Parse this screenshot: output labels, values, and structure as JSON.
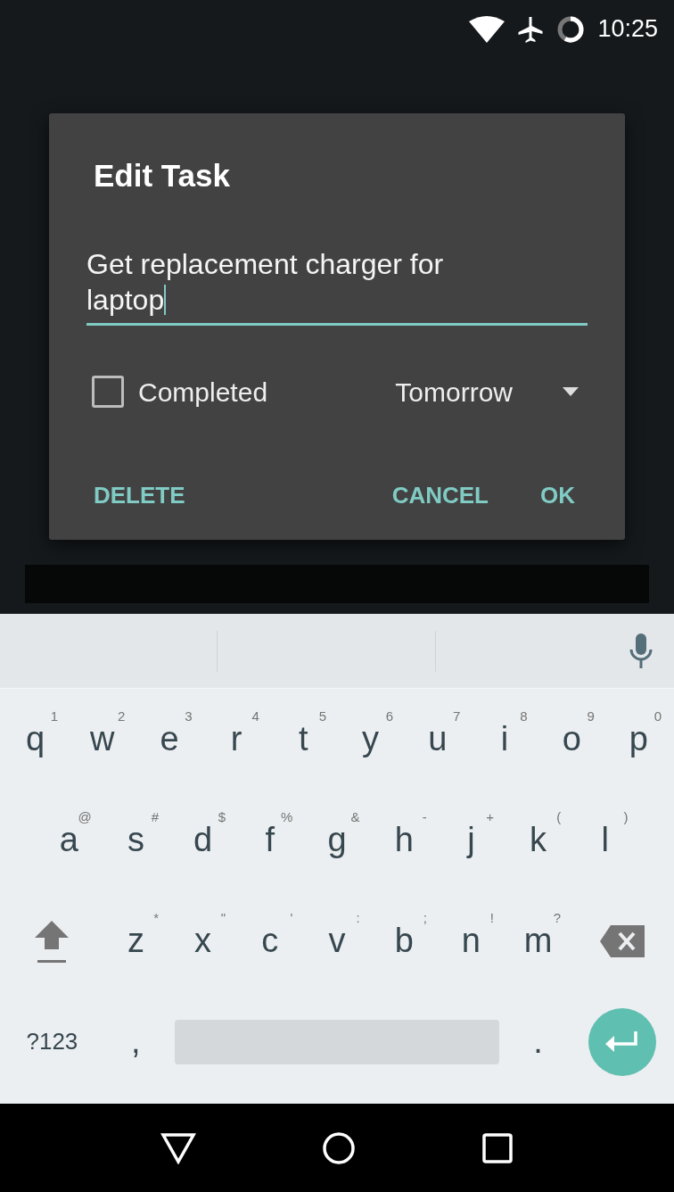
{
  "status_bar": {
    "time": "10:25"
  },
  "dialog": {
    "title": "Edit Task",
    "task_text": "Get replacement charger for laptop",
    "completed": {
      "label": "Completed",
      "checked": false
    },
    "due": {
      "value": "Tomorrow"
    },
    "buttons": [
      {
        "label": "DELETE",
        "kind": "left"
      },
      {
        "label": "CANCEL",
        "kind": "right"
      },
      {
        "label": "OK",
        "kind": "right"
      }
    ]
  },
  "keyboard": {
    "rows": [
      {
        "keys": [
          {
            "kind": "letter",
            "label": "q",
            "hint": "1"
          },
          {
            "kind": "letter",
            "label": "w",
            "hint": "2"
          },
          {
            "kind": "letter",
            "label": "e",
            "hint": "3"
          },
          {
            "kind": "letter",
            "label": "r",
            "hint": "4"
          },
          {
            "kind": "letter",
            "label": "t",
            "hint": "5"
          },
          {
            "kind": "letter",
            "label": "y",
            "hint": "6"
          },
          {
            "kind": "letter",
            "label": "u",
            "hint": "7"
          },
          {
            "kind": "letter",
            "label": "i",
            "hint": "8"
          },
          {
            "kind": "letter",
            "label": "o",
            "hint": "9"
          },
          {
            "kind": "letter",
            "label": "p",
            "hint": "0"
          }
        ]
      },
      {
        "keys": [
          {
            "kind": "letter",
            "label": "a",
            "hint": "@"
          },
          {
            "kind": "letter",
            "label": "s",
            "hint": "#"
          },
          {
            "kind": "letter",
            "label": "d",
            "hint": "$"
          },
          {
            "kind": "letter",
            "label": "f",
            "hint": "%"
          },
          {
            "kind": "letter",
            "label": "g",
            "hint": "&"
          },
          {
            "kind": "letter",
            "label": "h",
            "hint": "-"
          },
          {
            "kind": "letter",
            "label": "j",
            "hint": "+"
          },
          {
            "kind": "letter",
            "label": "k",
            "hint": "("
          },
          {
            "kind": "letter",
            "label": "l",
            "hint": ")"
          }
        ]
      },
      {
        "keys": [
          {
            "kind": "shift"
          },
          {
            "kind": "letter",
            "label": "z",
            "hint": "*"
          },
          {
            "kind": "letter",
            "label": "x",
            "hint": "\""
          },
          {
            "kind": "letter",
            "label": "c",
            "hint": "'"
          },
          {
            "kind": "letter",
            "label": "v",
            "hint": ":"
          },
          {
            "kind": "letter",
            "label": "b",
            "hint": ";"
          },
          {
            "kind": "letter",
            "label": "n",
            "hint": "!"
          },
          {
            "kind": "letter",
            "label": "m",
            "hint": "?"
          },
          {
            "kind": "backspace"
          }
        ]
      },
      {
        "keys": [
          {
            "kind": "symbols",
            "label": "?123"
          },
          {
            "kind": "punct",
            "label": ","
          },
          {
            "kind": "space"
          },
          {
            "kind": "punct",
            "label": "."
          },
          {
            "kind": "enter"
          }
        ]
      }
    ]
  }
}
